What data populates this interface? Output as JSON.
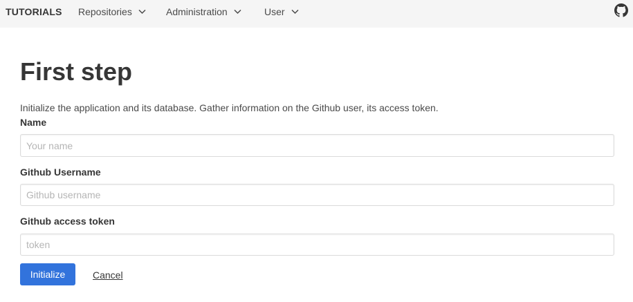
{
  "navbar": {
    "brand": "TUTORIALS",
    "items": [
      {
        "label": "Repositories",
        "icon": "chevron-down-icon"
      },
      {
        "label": "Administration",
        "icon": "chevron-down-icon"
      },
      {
        "label": "User",
        "icon": "chevron-down-icon"
      }
    ],
    "github_icon": "github-icon"
  },
  "main": {
    "title": "First step",
    "subtitle": "Initialize the application and its database. Gather information on the Github user, its access token.",
    "fields": [
      {
        "label": "Name",
        "placeholder": "Your name",
        "value": ""
      },
      {
        "label": "Github Username",
        "placeholder": "Github username",
        "value": ""
      },
      {
        "label": "Github access token",
        "placeholder": "token",
        "value": ""
      }
    ],
    "initialize_label": "Initialize",
    "cancel_label": "Cancel"
  },
  "colors": {
    "navbar_bg": "#f5f5f5",
    "primary": "#3273dc",
    "text": "#363636",
    "border": "#dbdbdb"
  }
}
